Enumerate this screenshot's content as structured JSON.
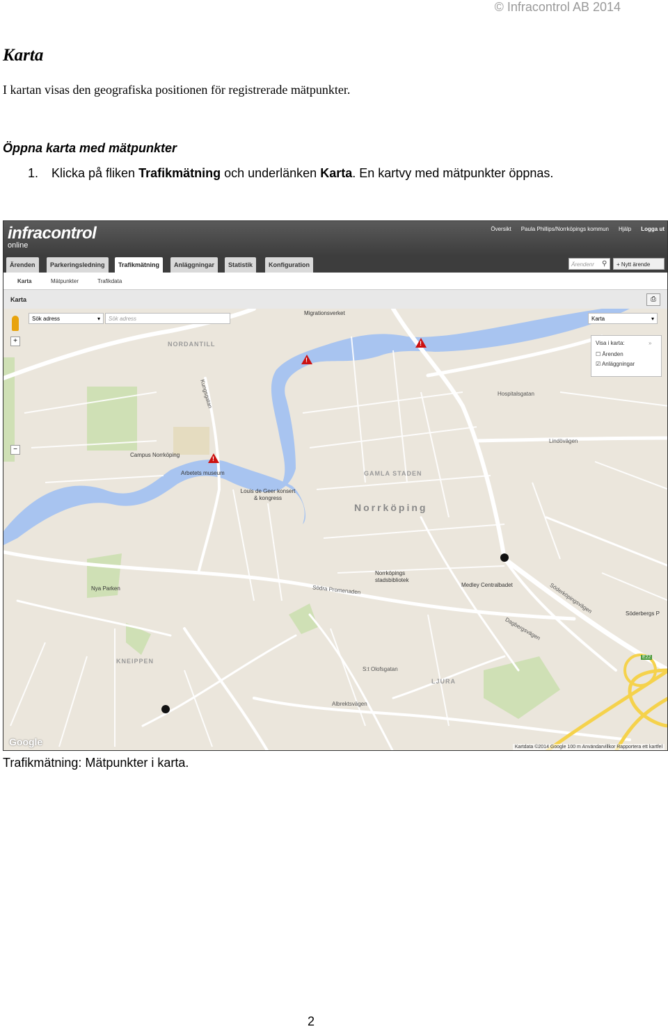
{
  "header": {
    "copyright": "© Infracontrol AB 2014"
  },
  "section": {
    "title": "Karta",
    "intro": "I kartan visas den geografiska positionen för registrerade mätpunkter."
  },
  "subsection": {
    "title": "Öppna karta med mätpunkter"
  },
  "step": {
    "number": "1.",
    "text_1": "Klicka på fliken ",
    "bold_1": "Trafikmätning",
    "text_2": " och underlänken ",
    "bold_2": "Karta",
    "text_3": ". En kartvy med mätpunkter öppnas."
  },
  "screenshot": {
    "logo": "infracontrol",
    "logo_sub": "online",
    "top_links": [
      "Översikt",
      "Paula Phillips/Norrköpings kommun",
      "Hjälp",
      "Logga ut"
    ],
    "tabs": [
      "Ärenden",
      "Parkeringsledning",
      "Trafikmätning",
      "Anläggningar",
      "Statistik",
      "Konfiguration"
    ],
    "active_tab": "Trafikmätning",
    "search_placeholder": "Ärendenr",
    "new_case_button": "Nytt ärende",
    "subnav": [
      "Karta",
      "Mätpunkter",
      "Trafikdata"
    ],
    "panel_title": "Karta",
    "map": {
      "address_select": "Sök adress",
      "address_placeholder": "Sök adress",
      "map_type": "Karta",
      "layers_title": "Visa i karta:",
      "layers": [
        {
          "label": "Ärenden",
          "checked": false
        },
        {
          "label": "Anläggningar",
          "checked": true
        }
      ],
      "labels": {
        "migrationsverket": "Migrationsverket",
        "nordantill": "NORDANTILL",
        "gamla_staden": "GAMLA STADEN",
        "norrkoping": "Norrköping",
        "kneippen": "KNEIPPEN",
        "ljura": "LJURA",
        "campus": "Campus Norrköping",
        "arbetets": "Arbetets museum",
        "louis": "Louis de Geer konsert & kongress",
        "nya_parken": "Nya Parken",
        "bibliotek": "Norrköpings stadsbibliotek",
        "medley": "Medley Centralbadet",
        "soderbergs": "Söderbergs P",
        "s_olofsgatan": "S:t Olofsgatan",
        "sodra_promenaden": "Södra Promenaden",
        "hospitalsgatan": "Hospitalsgatan",
        "lindovagen": "Lindövägen",
        "dagbergsvagen": "Dagbergsvägen",
        "soderkopingsvagen": "Söderköpingsvägen",
        "albrektsvagen": "Albrektsvägen",
        "kungsgatan": "Kungsgatan",
        "e22": "E22"
      },
      "google": "Google",
      "attribution": "Kartdata ©2014 Google   100 m   Användarvillkor   Rapportera ett kartfel"
    }
  },
  "caption": "Trafikmätning: Mätpunkter i karta.",
  "page_number": "2"
}
